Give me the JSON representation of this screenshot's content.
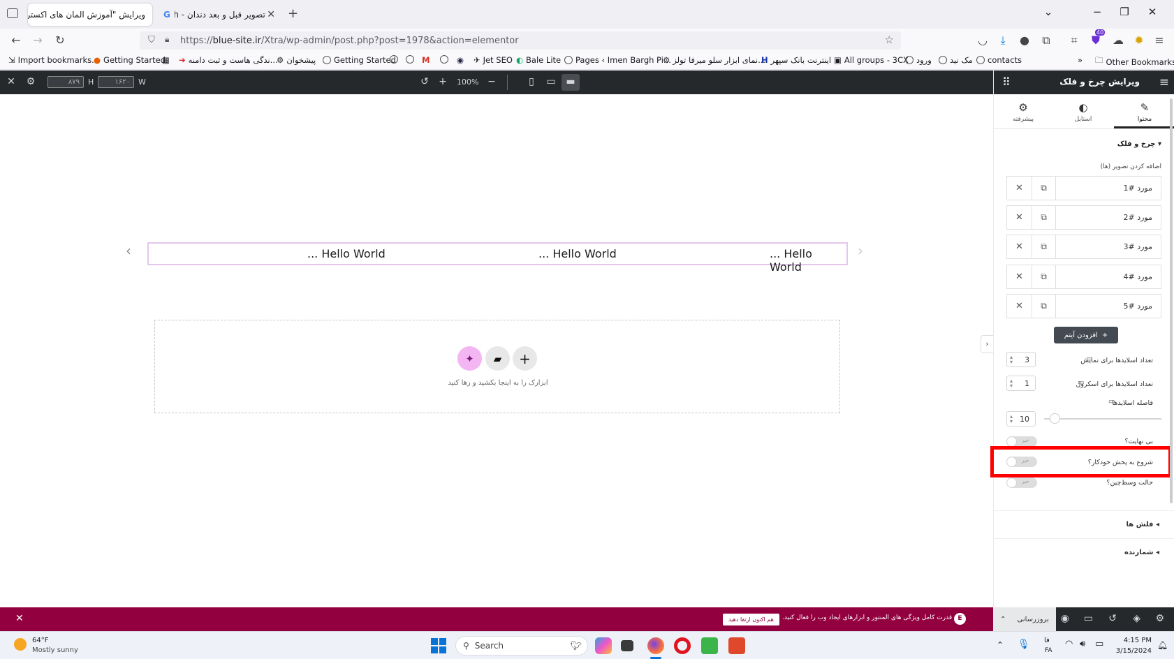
{
  "browser": {
    "tabs": [
      {
        "label": "ویرایش \"آموزش المان های اکسترا - ..."
      },
      {
        "label": "تصویر قبل و بعد دندان - Search"
      }
    ],
    "url_prefix": "https://",
    "url_domain": "blue-site.ir",
    "url_path": "/Xtra/wp-admin/post.php?post=1978&action=elementor",
    "extension_badge": "40",
    "bookmarks": [
      "Import bookmarks...",
      "Getting Started",
      "...ندگی هاست و ثبت دامنه",
      "پیشخوان",
      "Getting Started",
      "Jet SEO",
      "Bale Lite",
      "Pages ‹ Imen Bargh Pi...",
      "...نمای ابزار سلو میرفا تولز",
      "اینترنت بانک سپهر",
      "All groups - 3CX",
      "ورود",
      "مک نید",
      "contacts"
    ],
    "other_bookmarks": "Other Bookmarks"
  },
  "editor_top": {
    "height_value": "۸۷۹",
    "height_label": "H",
    "width_value": "۱۶۲۰",
    "width_label": "W",
    "zoom": "100%"
  },
  "canvas": {
    "slides": [
      "... Hello World",
      "... Hello World",
      "... Hello World"
    ],
    "dropzone_text": "ابزارک را به اینجا بکشید و رها کنید"
  },
  "panel": {
    "title": "ویرایش چرخ و فلک",
    "tabs": {
      "content": "محتوا",
      "style": "استایل",
      "advanced": "پیشرفته"
    },
    "section_title": "چرخ و فلک",
    "images_label": "اضافه کردن تصویر (ها)",
    "items": [
      "مورد #1",
      "مورد #2",
      "مورد #3",
      "مورد #4",
      "مورد #5"
    ],
    "add_item": "افزودن آیتم",
    "slides_to_show_label": "تعداد اسلایدها برای نمایش",
    "slides_to_show_value": "3",
    "slides_to_scroll_label": "تعداد اسلایدها برای اسکرول",
    "slides_to_scroll_value": "1",
    "slide_gap_label": "فاصله اسلایدها",
    "slide_gap_value": "10",
    "slide_gap_fraction": 0.1,
    "infinite_label": "بی نهایت؟",
    "autoplay_label": "شروع به پخش خودکار؟",
    "center_mode_label": "حالت وسط‌چین؟",
    "toggle_off": "خیر",
    "arrows_section": "فلش ها",
    "counter_section": "شمارنده"
  },
  "promo": {
    "message": "قدرت کامل ویژگی های المنتور و ابزارهای ایجاد وب را فعال کنید.",
    "cta": "هم اکنون ارتقا دهید",
    "update_label": "بروزرسانی"
  },
  "taskbar": {
    "temperature": "64°F",
    "weather": "Mostly sunny",
    "search": "Search",
    "lang1": "فا",
    "lang2": "FA",
    "time": "4:15 PM",
    "date": "3/15/2024"
  },
  "colors": {
    "highlight": "#ff0000",
    "promo_bg": "#93003f",
    "editor_dark": "#26292c",
    "ai_pink": "#f3b6f3"
  }
}
